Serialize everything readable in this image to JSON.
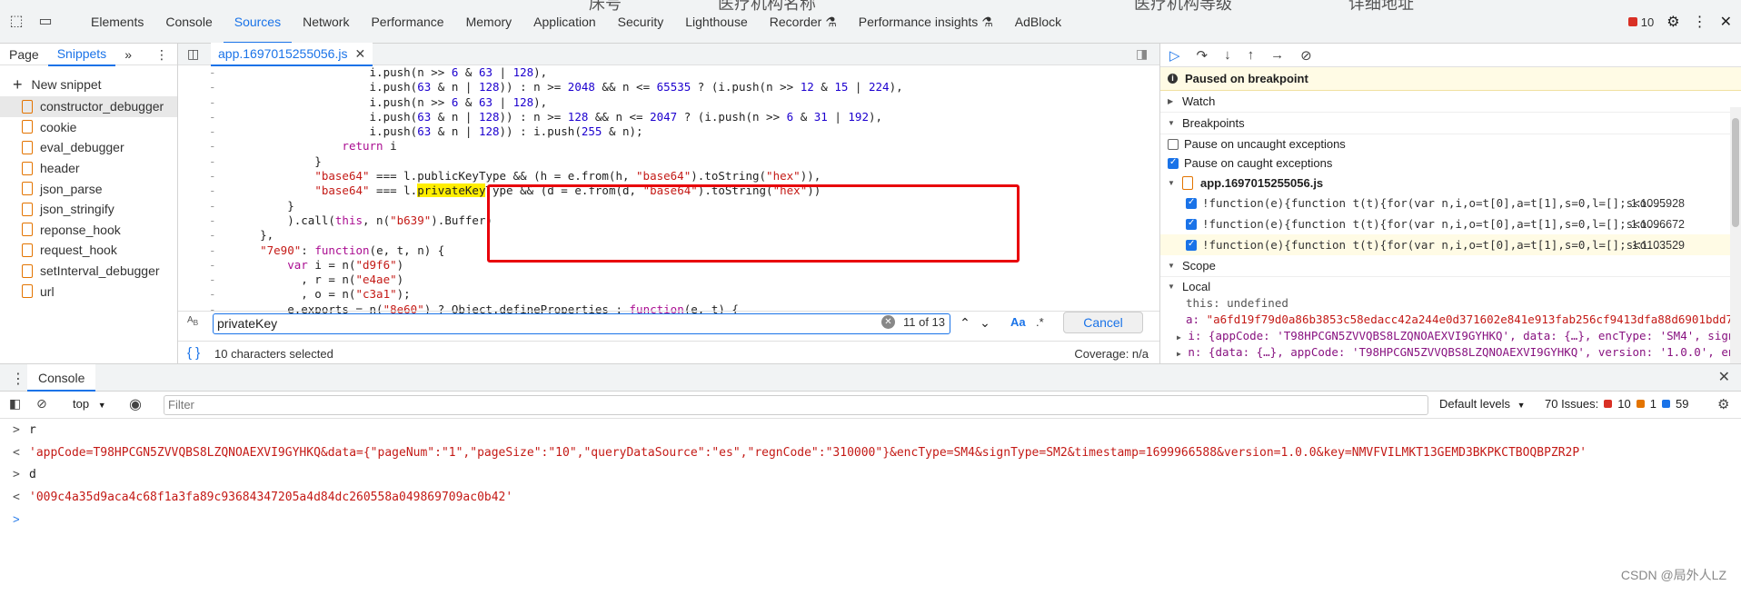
{
  "topbar": {
    "bg_texts": [
      "床号",
      "医疗机构名称",
      "医疗机构等级",
      "详细地址"
    ],
    "tabs": [
      "Elements",
      "Console",
      "Sources",
      "Network",
      "Performance",
      "Memory",
      "Application",
      "Security",
      "Lighthouse",
      "Recorder ⚗",
      "Performance insights ⚗",
      "AdBlock"
    ],
    "active_tab": "Sources",
    "error_count": "10"
  },
  "navigator": {
    "tabs": [
      "Page",
      "Snippets"
    ],
    "more": "»",
    "new_snippet": "New snippet",
    "snippets": [
      "constructor_debugger",
      "cookie",
      "eval_debugger",
      "header",
      "json_parse",
      "json_stringify",
      "reponse_hook",
      "request_hook",
      "setInterval_debugger",
      "url"
    ]
  },
  "editor": {
    "file_tab": "app.1697015255056.js",
    "lines": [
      {
        "g": "-",
        "t": "                    i.push(n >> 6 & 63 | 128),"
      },
      {
        "g": "-",
        "t": "                    i.push(63 & n | 128)) : n >= 2048 && n <= 65535 ? (i.push(n >> 12 & 15 | 224),"
      },
      {
        "g": "-",
        "t": "                    i.push(n >> 6 & 63 | 128),"
      },
      {
        "g": "-",
        "t": "                    i.push(63 & n | 128)) : n >= 128 && n <= 2047 ? (i.push(n >> 6 & 31 | 192),"
      },
      {
        "g": "-",
        "t": "                    i.push(63 & n | 128)) : i.push(255 & n);"
      },
      {
        "g": "-",
        "t": "                return i"
      },
      {
        "g": "-",
        "t": "            }"
      },
      {
        "g": "-",
        "t": "            \"base64\" === l.publicKeyType && (h = e.from(h, \"base64\").toString(\"hex\")),"
      },
      {
        "g": "-",
        "t": "            \"base64\" === l.privateKeyType && (d = e.from(d, \"base64\").toString(\"hex\"))"
      },
      {
        "g": "-",
        "t": "        }"
      },
      {
        "g": "-",
        "t": "        ).call(this, n(\"b639\").Buffer)"
      },
      {
        "g": "-",
        "t": "    },"
      },
      {
        "g": "-",
        "t": "    \"7e90\": function(e, t, n) {"
      },
      {
        "g": "-",
        "t": "        var i = n(\"d9f6\")"
      },
      {
        "g": "-",
        "t": "          , r = n(\"e4ae\")"
      },
      {
        "g": "-",
        "t": "          , o = n(\"c3a1\");"
      },
      {
        "g": "-",
        "t": "        e.exports = n(\"8e60\") ? Object.defineProperties : function(e, t) {"
      }
    ],
    "highlight_word": "privateKey"
  },
  "search": {
    "query": "privateKey",
    "count": "11 of 13",
    "match_case": "Aa",
    "regex": ".*",
    "cancel": "Cancel"
  },
  "status": {
    "selection": "10 characters selected",
    "coverage": "Coverage: n/a"
  },
  "debugger": {
    "paused": "Paused on breakpoint",
    "watch": "Watch",
    "breakpoints": "Breakpoints",
    "pause_uncaught": "Pause on uncaught exceptions",
    "pause_caught": "Pause on caught exceptions",
    "bp_file": "app.1697015255056.js",
    "bps": [
      {
        "code": "!function(e){function t(t){for(var n,i,o=t[0],a=t[1],s=0,l=[];s<o...",
        "loc": "1:1095928"
      },
      {
        "code": "!function(e){function t(t){for(var n,i,o=t[0],a=t[1],s=0,l=[];s<o...",
        "loc": "1:1096672"
      },
      {
        "code": "!function(e){function t(t){for(var n,i,o=t[0],a=t[1],s=0,l=[];s<o...",
        "loc": "1:1103529"
      }
    ],
    "scope": "Scope",
    "local": "Local",
    "scope_this": "this: undefined",
    "scope_a_key": "a:",
    "scope_a_val": "\"a6fd19f79d0a86b3853c58edacc42a244e0d371602e841e913fab256cf9413dfa88d6901bdd7",
    "scope_i": "i: {appCode: 'T98HPCGN5ZVVQBS8LZQNOAEXVI9GYHKQ', data: {…}, encType: 'SM4', sign",
    "scope_n": "n: {data: {…}, appCode: 'T98HPCGN5ZVVQBS8LZQNOAEXVI9GYHKQ', version: '1.0.0', en"
  },
  "drawer": {
    "tab": "Console",
    "context": "top",
    "filter_placeholder": "Filter",
    "levels": "Default levels",
    "issues_label": "70 Issues:",
    "issues_err": "10",
    "issues_warn": "1",
    "issues_info": "59",
    "log": [
      {
        "pfx": ">",
        "text": "r",
        "res": false
      },
      {
        "pfx": "<",
        "text": "'appCode=T98HPCGN5ZVVQBS8LZQNOAEXVI9GYHKQ&data={\"pageNum\":\"1\",\"pageSize\":\"10\",\"queryDataSource\":\"es\",\"regnCode\":\"310000\"}&encType=SM4&signType=SM2&timestamp=1699966588&version=1.0.0&key=NMVFVILMKT13GEMD3BKPKCTBOQBPZR2P'",
        "res": true
      },
      {
        "pfx": ">",
        "text": "d",
        "res": false
      },
      {
        "pfx": "<",
        "text": "'009c4a35d9aca4c68f1a3fa89c93684347205a4d84dc260558a049869709ac0b42'",
        "res": true
      }
    ],
    "prompt": ">"
  },
  "watermark": "CSDN @局外人LZ"
}
